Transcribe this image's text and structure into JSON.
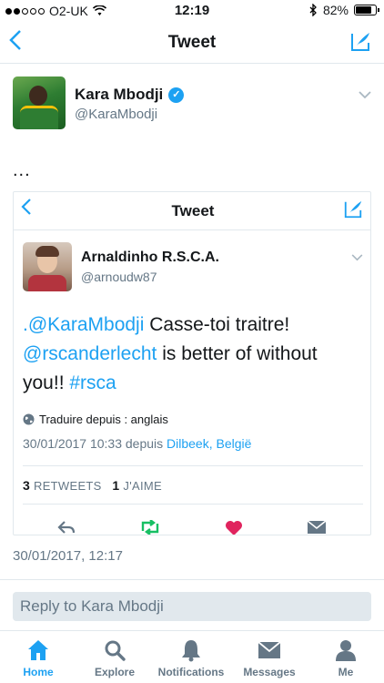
{
  "status_bar": {
    "carrier": "O2-UK",
    "time": "12:19",
    "battery": "82%",
    "battery_level": 0.82
  },
  "nav": {
    "title": "Tweet",
    "back_icon": "chevron-left-icon",
    "compose_icon": "compose-icon"
  },
  "tweet": {
    "author_name": "Kara Mbodji",
    "author_handle": "@KaraMbodji",
    "body": "...",
    "timestamp": "30/01/2017, 12:17"
  },
  "embedded": {
    "nav_title": "Tweet",
    "author_name": "Arnaldinho R.S.C.A.",
    "author_handle": "@arnoudw87",
    "text_prefix": ".",
    "mention1": "@KaraMbodji",
    "text_mid": " Casse-toi traitre!",
    "mention2": "@rscanderlecht",
    "text_tail": " is better of without you!! ",
    "hashtag": "#rsca",
    "translate": "Traduire depuis : anglais",
    "date": "30/01/2017 10:33 depuis",
    "place": "Dilbeek, België",
    "retweets_count": "3",
    "retweets_label": "RETWEETS",
    "likes_count": "1",
    "likes_label": "J'AIME"
  },
  "reply": {
    "placeholder": "Reply to Kara Mbodji"
  },
  "tabs": [
    {
      "label": "Home",
      "icon": "home-icon"
    },
    {
      "label": "Explore",
      "icon": "search-icon"
    },
    {
      "label": "Notifications",
      "icon": "bell-icon"
    },
    {
      "label": "Messages",
      "icon": "envelope-icon"
    },
    {
      "label": "Me",
      "icon": "person-icon"
    }
  ],
  "colors": {
    "accent": "#1da1f2",
    "retweet": "#17bf63",
    "like": "#e0245e",
    "muted": "#657786"
  }
}
